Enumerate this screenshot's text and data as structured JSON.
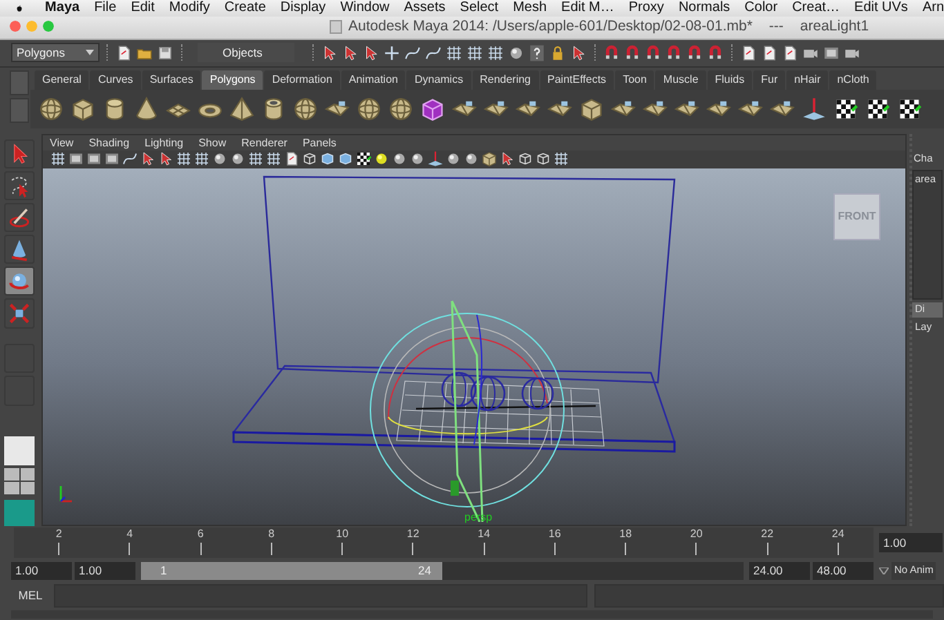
{
  "menu_bar": {
    "app": "Maya",
    "items": [
      "File",
      "Edit",
      "Modify",
      "Create",
      "Display",
      "Window",
      "Assets",
      "Select",
      "Mesh",
      "Edit M…",
      "Proxy",
      "Normals",
      "Color",
      "Creat…",
      "Edit UVs",
      "Arn"
    ]
  },
  "title_bar": {
    "title": "Autodesk Maya 2014: /Users/apple-601/Desktop/02-08-01.mb*",
    "separator": "---",
    "object": "areaLight1"
  },
  "status_line": {
    "menu_set": "Polygons",
    "selection_mode": "Objects"
  },
  "shelf": {
    "tabs": [
      {
        "label": "General",
        "selected": false
      },
      {
        "label": "Curves",
        "selected": false
      },
      {
        "label": "Surfaces",
        "selected": false
      },
      {
        "label": "Polygons",
        "selected": true
      },
      {
        "label": "Deformation",
        "selected": false
      },
      {
        "label": "Animation",
        "selected": false
      },
      {
        "label": "Dynamics",
        "selected": false
      },
      {
        "label": "Rendering",
        "selected": false
      },
      {
        "label": "PaintEffects",
        "selected": false
      },
      {
        "label": "Toon",
        "selected": false
      },
      {
        "label": "Muscle",
        "selected": false
      },
      {
        "label": "Fluids",
        "selected": false
      },
      {
        "label": "Fur",
        "selected": false
      },
      {
        "label": "nHair",
        "selected": false
      },
      {
        "label": "nCloth",
        "selected": false
      }
    ]
  },
  "toolbox": {
    "tools": [
      {
        "kind": "select",
        "selected": false
      },
      {
        "kind": "lasso",
        "selected": false
      },
      {
        "kind": "paint",
        "selected": false
      },
      {
        "kind": "move",
        "selected": false
      },
      {
        "kind": "rotate",
        "selected": true
      },
      {
        "kind": "scale",
        "selected": false
      },
      {
        "kind": "blank",
        "selected": false
      },
      {
        "kind": "blank",
        "selected": false
      }
    ]
  },
  "viewport": {
    "menus": [
      "View",
      "Shading",
      "Lighting",
      "Show",
      "Renderer",
      "Panels"
    ],
    "view_cube": "FRONT",
    "camera": "persp"
  },
  "channel_box": {
    "heading": "Cha",
    "object": "area",
    "tabs": [
      {
        "label": "Di",
        "selected": true
      },
      {
        "label": "Lay",
        "selected": false
      }
    ]
  },
  "time_slider": {
    "ticks": [
      "2",
      "4",
      "6",
      "8",
      "10",
      "12",
      "14",
      "16",
      "18",
      "20",
      "22",
      "24"
    ],
    "current_time": "1.00"
  },
  "range_slider": {
    "start_time": "1.00",
    "playback_start": "1.00",
    "range_start": "1",
    "range_end": "24",
    "level": 0.5,
    "playback_end": "24.00",
    "end_time": "48.00",
    "anim_layer": "No Anim"
  },
  "command_line": {
    "language": "MEL"
  }
}
